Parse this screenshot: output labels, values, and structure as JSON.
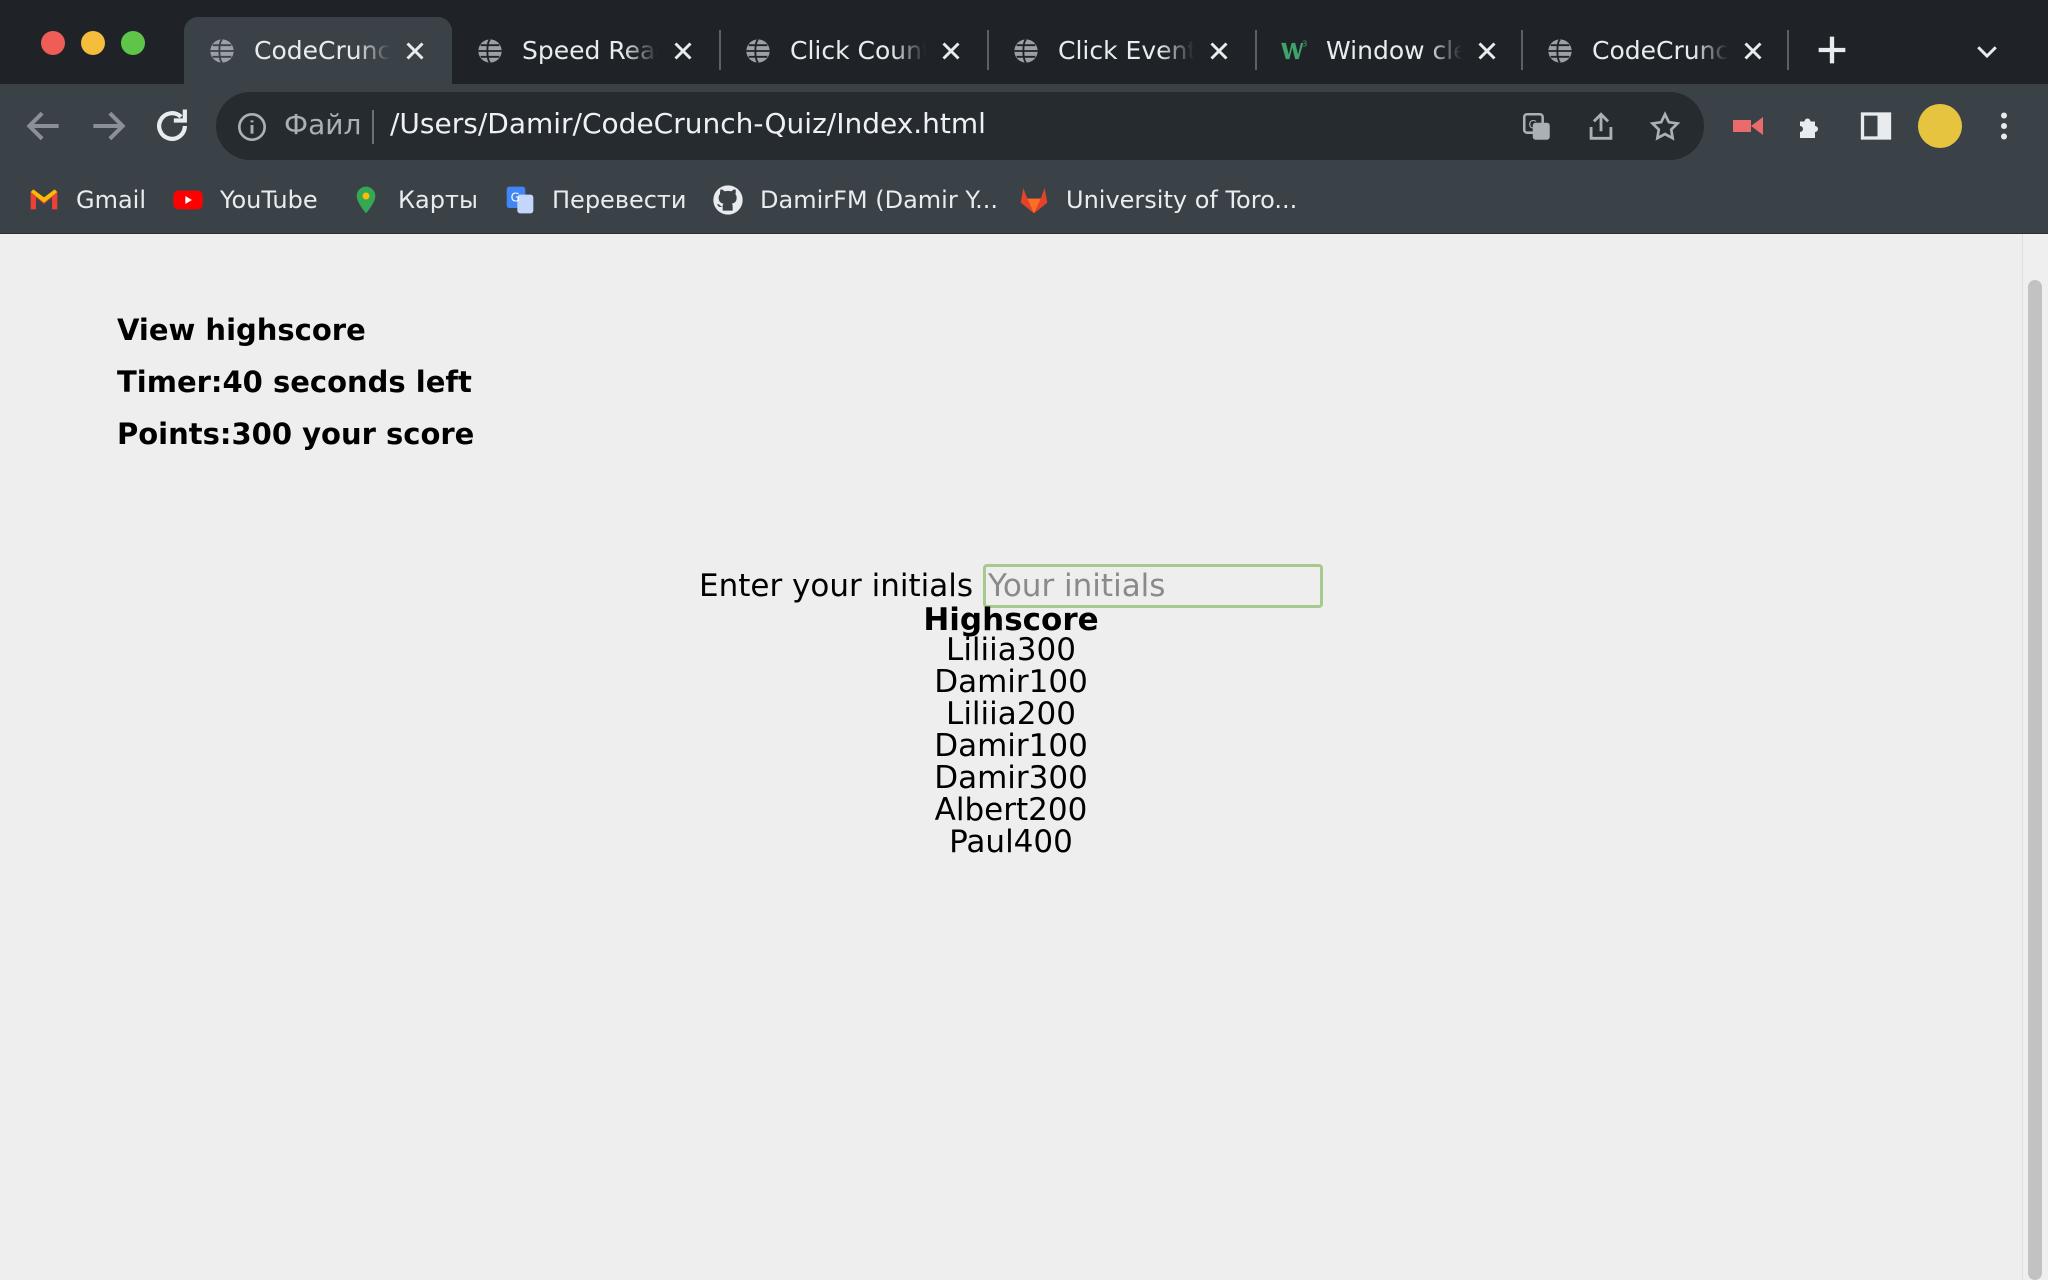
{
  "browser": {
    "tabs": [
      {
        "title": "CodeCrunch Quiz",
        "active": true,
        "icon": "globe-icon"
      },
      {
        "title": "Speed Reader",
        "active": false,
        "icon": "globe-icon"
      },
      {
        "title": "Click Counter",
        "active": false,
        "icon": "globe-icon"
      },
      {
        "title": "Click Event",
        "active": false,
        "icon": "globe-icon"
      },
      {
        "title": "Window clear",
        "active": false,
        "icon": "w3schools-icon"
      },
      {
        "title": "CodeCrunch Quiz",
        "active": false,
        "icon": "globe-icon"
      }
    ],
    "address": {
      "scheme_label": "Файл",
      "url": "/Users/Damir/CodeCrunch-Quiz/Index.html"
    },
    "bookmarks": [
      {
        "label": "Gmail",
        "icon": "gmail-icon"
      },
      {
        "label": "YouTube",
        "icon": "youtube-icon"
      },
      {
        "label": "Карты",
        "icon": "maps-icon"
      },
      {
        "label": "Перевести",
        "icon": "translate-icon"
      },
      {
        "label": "DamirFM (Damir Y...",
        "icon": "github-icon"
      },
      {
        "label": "University of Toro...",
        "icon": "gitlab-icon"
      }
    ],
    "colors": {
      "tabstrip": "#1f2327",
      "toolbar": "#3a4248",
      "omnibox": "#262b30"
    }
  },
  "quiz": {
    "view_highscore": "View highscore",
    "timer_text": "Timer:40 seconds left",
    "points_text": "Points:300 your score",
    "initials_label": "Enter your initials",
    "initials_placeholder": "Your initials",
    "initials_value": "",
    "highscore_title": "Highscore",
    "highscores": [
      "Liliia300",
      "Damir100",
      "Liliia200",
      "Damir100",
      "Damir300",
      "Albert200",
      "Paul400"
    ]
  }
}
